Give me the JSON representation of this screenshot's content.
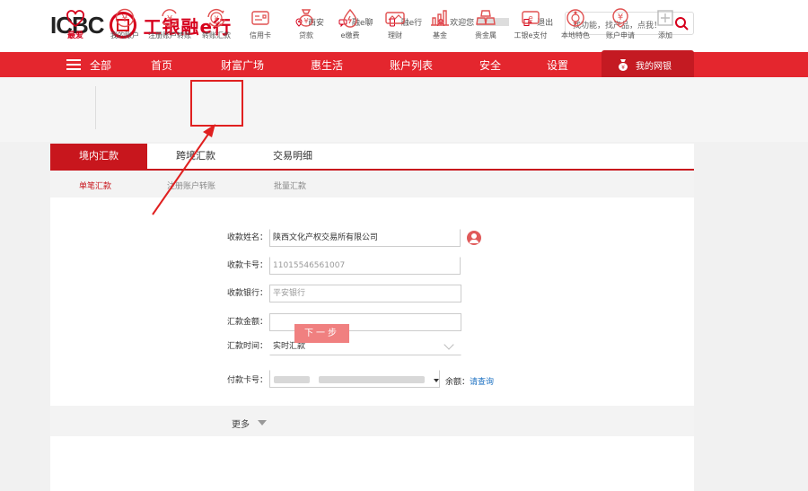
{
  "header": {
    "logo_text": "ICBC",
    "logo_cn": "工银融e行",
    "links": [
      {
        "label": "西安",
        "icon": "location-icon"
      },
      {
        "label": "融e聊",
        "icon": "chat-icon"
      },
      {
        "label": "融e行",
        "icon": "phone-icon"
      },
      {
        "label": "欢迎您",
        "icon": "user-icon"
      },
      {
        "label": "退出",
        "icon": "logout-icon"
      }
    ],
    "search_placeholder": "找功能，找产品，点我！"
  },
  "nav": {
    "items": [
      "全部",
      "首页",
      "财富广场",
      "惠生活",
      "账户列表",
      "安全",
      "设置"
    ],
    "my_net": "我的网银"
  },
  "quick": {
    "items": [
      {
        "label": "最爱",
        "icon": "heart-icon"
      },
      {
        "label": "我的账户",
        "icon": "yuan-coin-icon"
      },
      {
        "label": "注册账户转账",
        "icon": "yuan-transfer-icon"
      },
      {
        "label": "转账汇款",
        "icon": "yuan-exchange-icon"
      },
      {
        "label": "信用卡",
        "icon": "card-icon"
      },
      {
        "label": "贷款",
        "icon": "money-bag-icon"
      },
      {
        "label": "e缴费",
        "icon": "drop-icon"
      },
      {
        "label": "理财",
        "icon": "chart-box-icon"
      },
      {
        "label": "基金",
        "icon": "bar-chart-icon"
      },
      {
        "label": "贵金属",
        "icon": "gold-bars-icon"
      },
      {
        "label": "工银e支付",
        "icon": "epay-icon"
      },
      {
        "label": "本地特色",
        "icon": "local-icon"
      },
      {
        "label": "账户申请",
        "icon": "yuan-apply-icon"
      },
      {
        "label": "添加",
        "icon": "plus-icon"
      }
    ]
  },
  "tabs": [
    "境内汇款",
    "跨境汇款",
    "交易明细"
  ],
  "subtabs": [
    "单笔汇款",
    "注册账户转账",
    "批量汇款"
  ],
  "form": {
    "payee_name_label": "收款姓名：",
    "payee_name_value": "陕西文化产权交易所有限公司",
    "payee_card_label": "收款卡号：",
    "payee_card_value": "11015546561007",
    "payee_bank_label": "收款银行：",
    "payee_bank_value": "平安银行",
    "amount_label": "汇款金额：",
    "amount_value": "",
    "time_label": "汇款时间：",
    "time_value": "实时汇款",
    "pay_card_label": "付款卡号：",
    "balance_label": "余额：",
    "balance_link": "请查询"
  },
  "more_label": "更多",
  "next_label": "下一步",
  "colors": {
    "brand_red": "#e4262e",
    "dark_red": "#c8161d",
    "link_blue": "#1a6fc1"
  }
}
